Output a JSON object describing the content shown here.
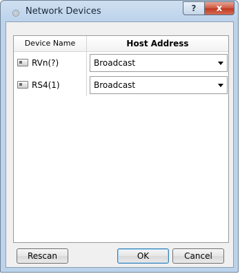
{
  "window": {
    "title": "Network Devices",
    "help_label": "?",
    "close_label": "x"
  },
  "table": {
    "columns": [
      "Device Name",
      "Host Address"
    ],
    "rows": [
      {
        "device_name": "RVn(?)",
        "host_address": "Broadcast"
      },
      {
        "device_name": "RS4(1)",
        "host_address": "Broadcast"
      }
    ]
  },
  "buttons": {
    "rescan": "Rescan",
    "ok": "OK",
    "cancel": "Cancel"
  },
  "icons": {
    "title": "gear-icon",
    "device": "device-icon",
    "dropdown": "chevron-down-icon"
  }
}
